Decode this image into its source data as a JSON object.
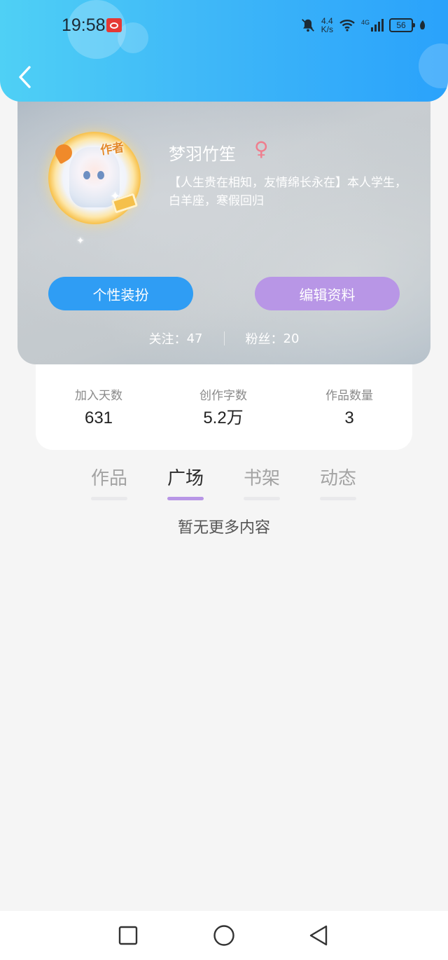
{
  "status_bar": {
    "time": "19:58",
    "net_speed_value": "4.4",
    "net_speed_unit": "K/s",
    "network_type": "4G",
    "battery": "56",
    "icons": [
      "app-notification-icon",
      "mute-bell-icon",
      "wifi-icon",
      "signal-icon",
      "battery-icon",
      "leaf-icon"
    ]
  },
  "header": {
    "back_icon": "chevron-left-icon"
  },
  "profile": {
    "avatar_tag": "作者",
    "username": "梦羽竹笙",
    "gender_symbol": "♀",
    "bio": "【人生贵在相知，友情绵长永在】本人学生，白羊座，寒假回归",
    "buttons": {
      "dress_up": "个性装扮",
      "edit_profile": "编辑资料"
    },
    "follow": {
      "following_label": "关注：",
      "following_count": "47",
      "fans_label": "粉丝：",
      "fans_count": "20"
    }
  },
  "stats": [
    {
      "label": "加入天数",
      "value": "631"
    },
    {
      "label": "创作字数",
      "value": "5.2万"
    },
    {
      "label": "作品数量",
      "value": "3"
    }
  ],
  "tabs": [
    {
      "label": "作品",
      "active": false
    },
    {
      "label": "广场",
      "active": true
    },
    {
      "label": "书架",
      "active": false
    },
    {
      "label": "动态",
      "active": false
    }
  ],
  "empty_message": "暂无更多内容",
  "colors": {
    "header_blue": "#3fb8f8",
    "dress_button": "#2f9df4",
    "edit_button": "#b896e6",
    "active_tab_underline": "#b896e6",
    "gender_pink": "#ef7e8e"
  },
  "nav_bar": [
    "square-recents-icon",
    "circle-home-icon",
    "triangle-back-icon"
  ]
}
